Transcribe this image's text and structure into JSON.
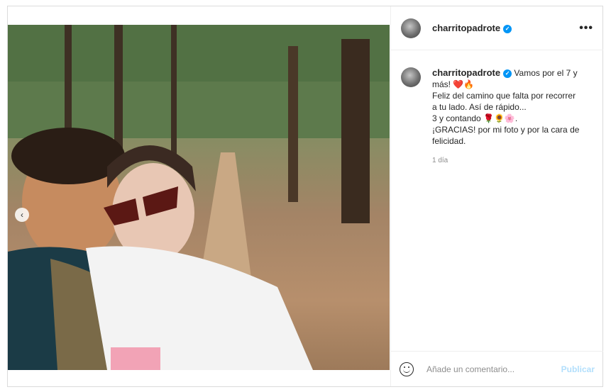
{
  "post": {
    "username": "charritopadrote",
    "verified": true,
    "caption_lines": [
      "Vamos por el 7 y",
      "más! ❤️🔥",
      "Feliz del camino que falta por recorrer",
      "a tu lado. Así de rápido...",
      "3 y contando 🌹🌻🌸.",
      "¡GRACIAS! por mi foto y por la cara de",
      "felicidad."
    ],
    "time_ago": "1 día"
  },
  "comment": {
    "placeholder": "Añade un comentario...",
    "publish_label": "Publicar"
  },
  "icons": {
    "verified": "verified-badge-icon",
    "more": "more-options-icon",
    "emoji": "emoji-icon",
    "carousel_prev": "chevron-left-icon"
  },
  "colors": {
    "verified": "#0095f6",
    "publish_disabled": "#b2dffc",
    "muted_text": "#8e8e8e"
  }
}
